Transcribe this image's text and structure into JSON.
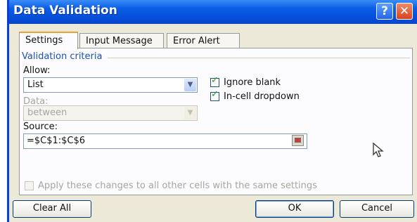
{
  "window": {
    "title": "Data Validation",
    "help_label": "?",
    "close_label": "✕"
  },
  "tabs": [
    {
      "label": "Settings",
      "active": true
    },
    {
      "label": "Input Message",
      "active": false
    },
    {
      "label": "Error Alert",
      "active": false
    }
  ],
  "criteria": {
    "group_label": "Validation criteria",
    "allow_label": "Allow:",
    "allow_value": "List",
    "data_label": "Data:",
    "data_value": "between",
    "source_label": "Source:",
    "source_value": "=$C$1:$C$6"
  },
  "checks": {
    "ignore_blank": {
      "label": "Ignore blank",
      "checked": true
    },
    "in_cell_dropdown": {
      "label": "In-cell dropdown",
      "checked": true
    },
    "apply_all": {
      "label": "Apply these changes to all other cells with the same settings",
      "checked": false
    }
  },
  "buttons": {
    "clear_all": "Clear All",
    "ok": "OK",
    "cancel": "Cancel"
  },
  "icons": {
    "help": "help-icon",
    "close": "close-icon",
    "dropdown": "chevron-down-icon",
    "refedit": "collapse-dialog-icon",
    "cursor": "mouse-pointer-icon"
  }
}
